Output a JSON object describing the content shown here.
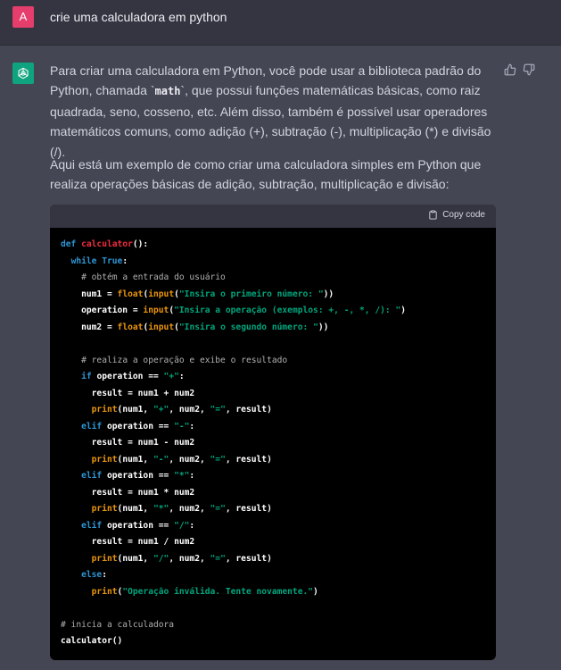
{
  "user": {
    "avatar_letter": "A",
    "message": "crie uma calculadora em python"
  },
  "assistant": {
    "p1_before": "Para criar uma calculadora em Python, você pode usar a biblioteca padrão do Python, chamada `",
    "p1_code": "math",
    "p1_after": "`, que possui funções matemáticas básicas, como raiz quadrada, seno, cosseno, etc. Além disso, também é possível usar operadores matemáticos comuns, como adição (+), subtração (-), multiplicação (*) e divisão (/).",
    "p2": "Aqui está um exemplo de como criar uma calculadora simples em Python que realiza operações básicas de adição, subtração, multiplicação e divisão:",
    "copy_label": "Copy code",
    "code_lines": [
      "def calculator():",
      "  while True:",
      "    # obtém a entrada do usuário",
      "    num1 = float(input(\"Insira o primeiro número: \"))",
      "    operation = input(\"Insira a operação (exemplos: +, -, *, /): \")",
      "    num2 = float(input(\"Insira o segundo número: \"))",
      "",
      "    # realiza a operação e exibe o resultado",
      "    if operation == \"+\":",
      "      result = num1 + num2",
      "      print(num1, \"+\", num2, \"=\", result)",
      "    elif operation == \"-\":",
      "      result = num1 - num2",
      "      print(num1, \"-\", num2, \"=\", result)",
      "    elif operation == \"*\":",
      "      result = num1 * num2",
      "      print(num1, \"*\", num2, \"=\", result)",
      "    elif operation == \"/\":",
      "      result = num1 / num2",
      "      print(num1, \"/\", num2, \"=\", result)",
      "    else:",
      "      print(\"Operação inválida. Tente novamente.\")",
      "",
      "# inicia a calculadora",
      "calculator()"
    ]
  },
  "colors": {
    "user_avatar": "#e53d6c",
    "bot_avatar": "#10a37f",
    "keyword": "#2e95d3",
    "function_name": "#f22c3d",
    "builtin": "#e9950c",
    "string": "#00a67d"
  }
}
